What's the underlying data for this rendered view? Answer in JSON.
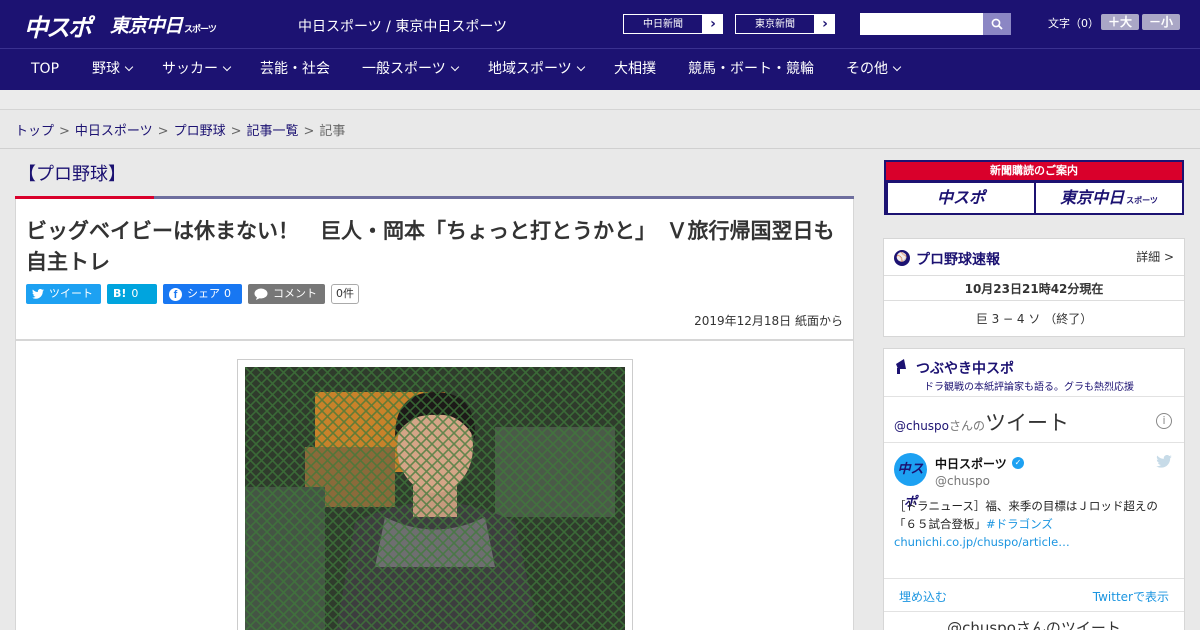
{
  "header": {
    "logo_chuspo": "中スポ",
    "logo_tokyo": "東京中日",
    "logo_tokyo_sub": "スポーツ",
    "site_name": "中日スポーツ / 東京中日スポーツ",
    "ext_links": [
      {
        "label": "中日新聞",
        "arrow": "›"
      },
      {
        "label": "東京新聞",
        "arrow": "›"
      }
    ],
    "search_placeholder": "",
    "fontsize_label": "文字（0）",
    "fontsize_plus": "＋大",
    "fontsize_minus": "－小"
  },
  "nav": {
    "items": [
      {
        "label": "TOP",
        "dropdown": false
      },
      {
        "label": "野球",
        "dropdown": true
      },
      {
        "label": "サッカー",
        "dropdown": true
      },
      {
        "label": "芸能・社会",
        "dropdown": false
      },
      {
        "label": "一般スポーツ",
        "dropdown": true
      },
      {
        "label": "地域スポーツ",
        "dropdown": true
      },
      {
        "label": "大相撲",
        "dropdown": false
      },
      {
        "label": "競馬・ボート・競輪",
        "dropdown": false
      },
      {
        "label": "その他",
        "dropdown": true
      }
    ]
  },
  "breadcrumb": {
    "items": [
      "トップ",
      "中日スポーツ",
      "プロ野球",
      "記事一覧"
    ],
    "current": "記事",
    "separator": ">"
  },
  "article": {
    "category": "【プロ野球】",
    "headline": "ビッグベイビーは休まない！　巨人・岡本「ちょっと打とうかと」　Ｖ旅行帰国翌日も自主トレ",
    "share": {
      "tweet_label": "ツイート",
      "hatena_label": "B!",
      "hatena_count": "0",
      "facebook_label": "シェア",
      "facebook_count": "0",
      "comment_label": "コメント",
      "comment_count": "0件"
    },
    "date": "2019年12月18日 紙面から"
  },
  "sidebar": {
    "subscribe_banner": {
      "title": "新聞購読のご案内",
      "left": "中スポ",
      "right": "東京中日",
      "right_sub": "スポーツ"
    },
    "score_widget": {
      "title": "プロ野球速報",
      "detail_link": "詳細 >",
      "timestamp": "10月23日21時42分現在",
      "score": "巨 3 − 4 ソ （終了）"
    },
    "tsubuyaki": {
      "title": "つぶやき中スポ",
      "subtitle": "ドラ観戦の本紙評論家も語る。グラも熱烈応援",
      "timeline_handle": "@chuspo",
      "timeline_suffix": "さんの",
      "timeline_title": "ツイート",
      "tweet": {
        "author": "中日スポーツ",
        "handle": "@chuspo",
        "text_plain": "［ドラニュース］福、来季の目標はＪロッド超えの「６５試合登板」",
        "hashtag": "#ドラゴンズ",
        "link": "chunichi.co.jp/chuspo/article…"
      },
      "embed_label": "埋め込む",
      "view_on_twitter": "Twitterで表示",
      "footer_handle_text": "@chuspoさんのツイート"
    }
  },
  "colors": {
    "navy": "#1c1272",
    "red": "#d9002b",
    "twitter": "#1da1f2",
    "facebook": "#1877f2",
    "hatena": "#00a4de"
  }
}
